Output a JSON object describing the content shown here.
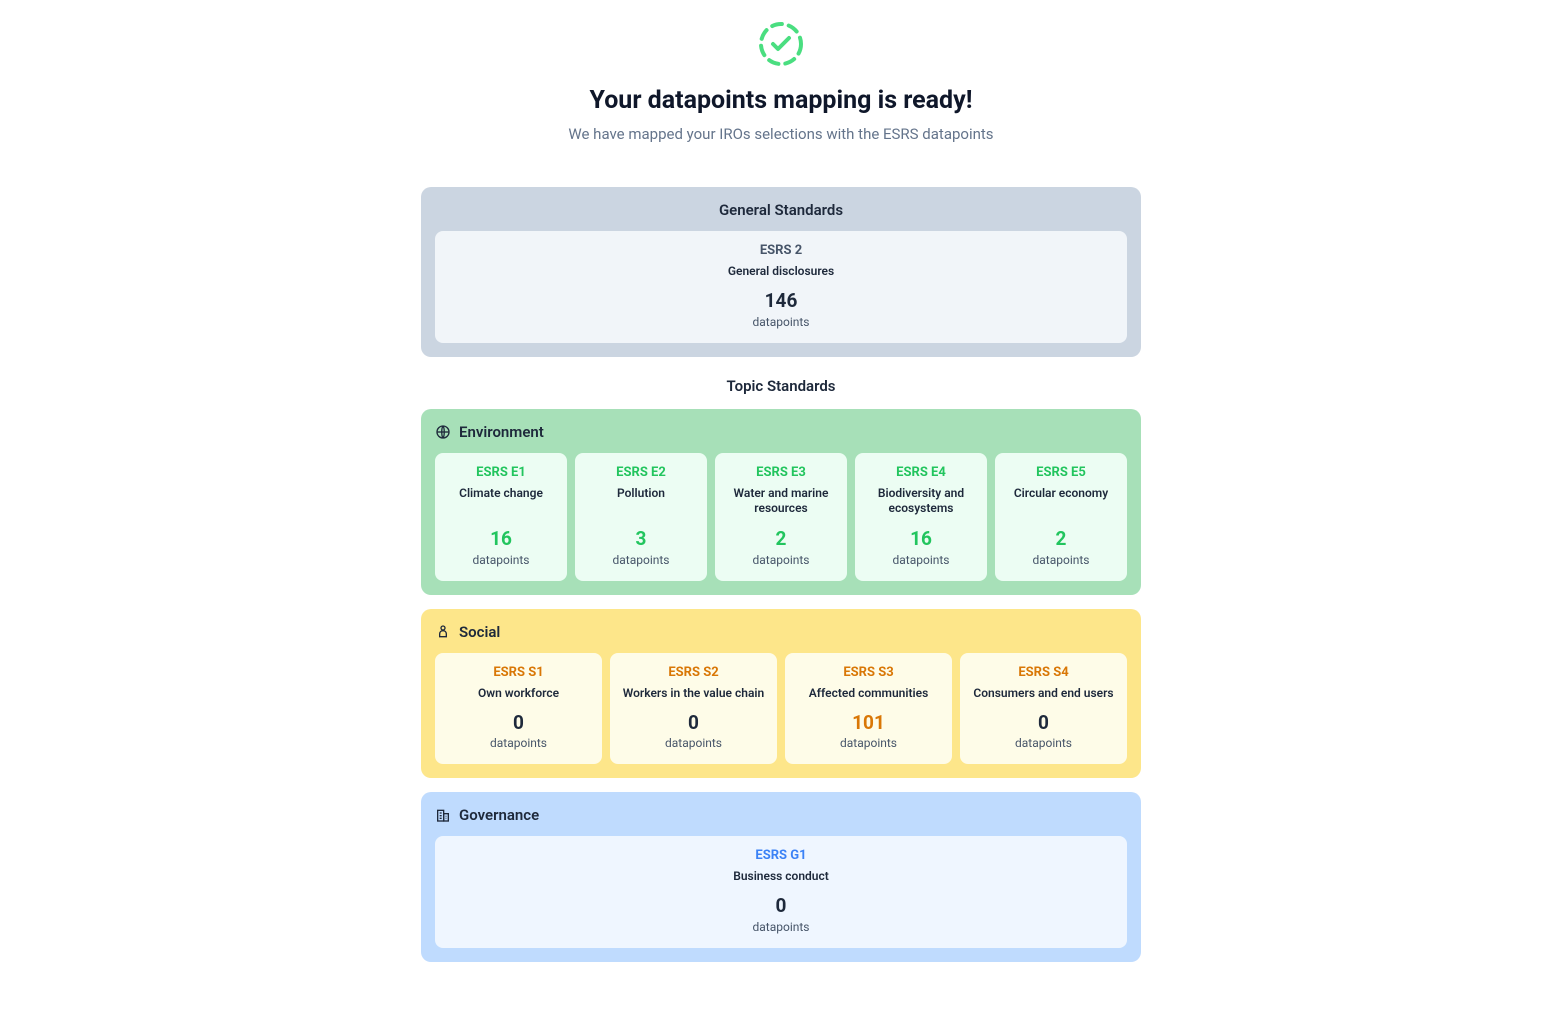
{
  "header": {
    "title": "Your datapoints mapping is ready!",
    "subtitle": "We have mapped your IROs selections with the ESRS datapoints"
  },
  "general": {
    "heading": "General Standards",
    "card": {
      "code": "ESRS 2",
      "desc": "General disclosures",
      "count": "146",
      "unit": "datapoints"
    }
  },
  "topic_heading": "Topic Standards",
  "environment": {
    "label": "Environment",
    "cards": [
      {
        "code": "ESRS E1",
        "desc": "Climate change",
        "count": "16",
        "unit": "datapoints"
      },
      {
        "code": "ESRS E2",
        "desc": "Pollution",
        "count": "3",
        "unit": "datapoints"
      },
      {
        "code": "ESRS E3",
        "desc": "Water and marine resources",
        "count": "2",
        "unit": "datapoints"
      },
      {
        "code": "ESRS E4",
        "desc": "Biodiversity and ecosystems",
        "count": "16",
        "unit": "datapoints"
      },
      {
        "code": "ESRS E5",
        "desc": "Circular economy",
        "count": "2",
        "unit": "datapoints"
      }
    ]
  },
  "social": {
    "label": "Social",
    "cards": [
      {
        "code": "ESRS S1",
        "desc": "Own workforce",
        "count": "0",
        "unit": "datapoints"
      },
      {
        "code": "ESRS S2",
        "desc": "Workers in the value chain",
        "count": "0",
        "unit": "datapoints"
      },
      {
        "code": "ESRS S3",
        "desc": "Affected communities",
        "count": "101",
        "unit": "datapoints"
      },
      {
        "code": "ESRS S4",
        "desc": "Consumers and end users",
        "count": "0",
        "unit": "datapoints"
      }
    ]
  },
  "governance": {
    "label": "Governance",
    "card": {
      "code": "ESRS G1",
      "desc": "Business conduct",
      "count": "0",
      "unit": "datapoints"
    }
  }
}
